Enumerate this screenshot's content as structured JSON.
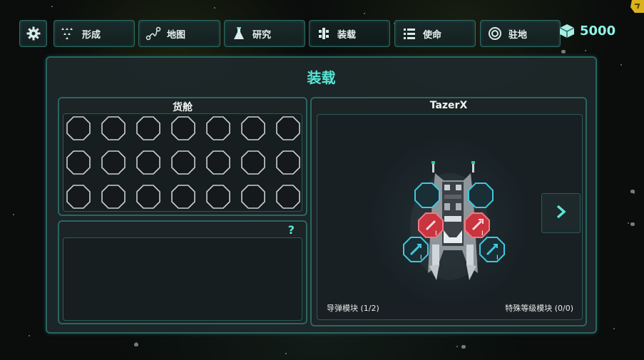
{
  "topbar": {
    "buttons": [
      {
        "label": "",
        "icon": "gear-icon"
      },
      {
        "label": "形成",
        "icon": "formation-icon"
      },
      {
        "label": "地图",
        "icon": "map-route-icon"
      },
      {
        "label": "研究",
        "icon": "flask-icon"
      },
      {
        "label": "装载",
        "icon": "loadout-icon"
      },
      {
        "label": "使命",
        "icon": "list-icon"
      },
      {
        "label": "驻地",
        "icon": "gear-base-icon"
      }
    ],
    "currency": "5000"
  },
  "panel": {
    "title": "装载",
    "cargo": {
      "title": "货舱",
      "help": "?"
    },
    "ship": {
      "name": "TazerX",
      "missile_modules": "导弹模块 (1/2)",
      "special_modules": "特殊等级模块 (0/0)"
    }
  },
  "colors": {
    "accent": "#59e6d6",
    "border": "#2a6662",
    "weapon_red": "#d03a45",
    "module_cyan": "#3fc8e0"
  }
}
